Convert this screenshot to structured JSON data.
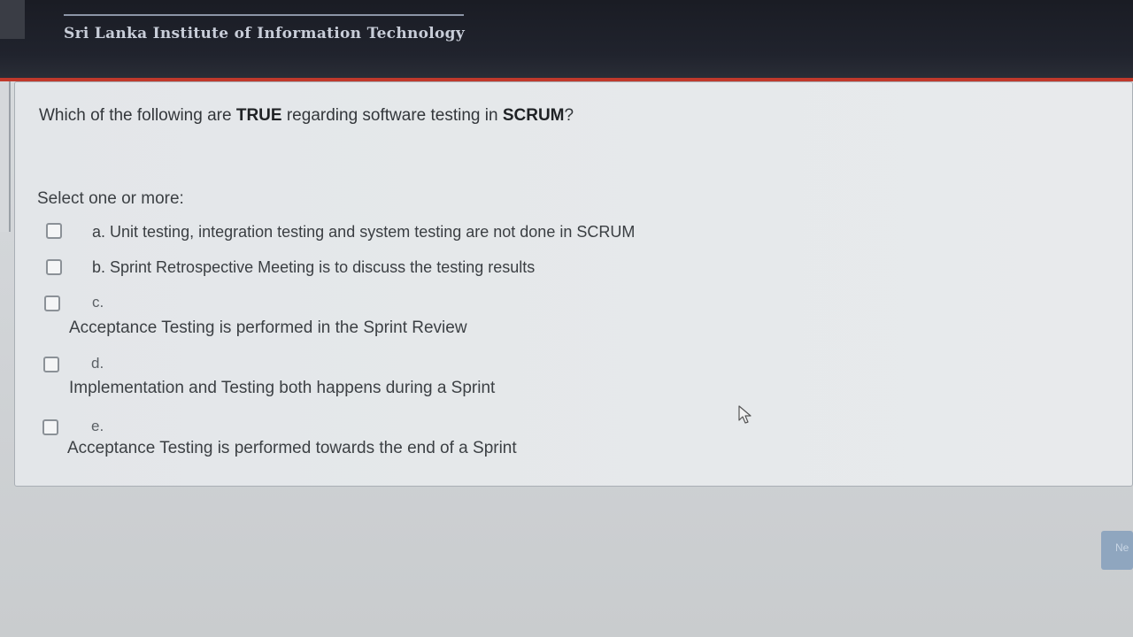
{
  "header": {
    "institute_name": "Sri Lanka Institute of Information Technology",
    "logo_icon": "sliit-logo-icon"
  },
  "question": {
    "text_parts": [
      {
        "text": "Which of the following are ",
        "bold": false
      },
      {
        "text": "TRUE",
        "bold": true
      },
      {
        "text": " regarding software testing in ",
        "bold": false
      },
      {
        "text": "SCRUM",
        "bold": true
      },
      {
        "text": "?",
        "bold": false
      }
    ],
    "select_prompt": "Select one or more:",
    "options": [
      {
        "letter": "a.",
        "text": "Unit testing, integration testing and system testing are not done in SCRUM",
        "checked": false
      },
      {
        "letter": "b.",
        "text": "Sprint Retrospective Meeting is to discuss the testing results",
        "checked": false
      },
      {
        "letter": "c.",
        "text": "Acceptance Testing is performed in the Sprint Review",
        "checked": false
      },
      {
        "letter": "d.",
        "text": "Implementation and Testing both happens during a Sprint",
        "checked": false
      },
      {
        "letter": "e.",
        "text": "Acceptance Testing is performed towards the end of a Sprint",
        "checked": false
      }
    ]
  },
  "navigation": {
    "next_label": "Ne"
  },
  "colors": {
    "header_bg": "#1f222b",
    "accent_red": "#c0392b",
    "next_button": "#8fa6bf"
  }
}
